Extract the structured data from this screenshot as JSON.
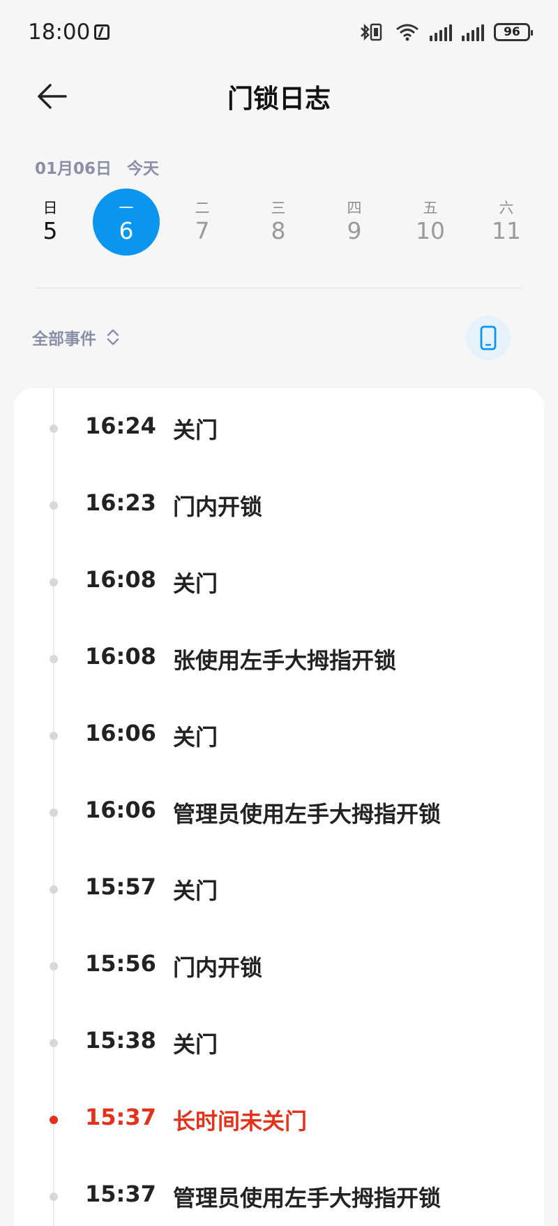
{
  "status_bar": {
    "time": "18:00",
    "battery": "96"
  },
  "header": {
    "title": "门锁日志"
  },
  "date": {
    "current": "01月06日",
    "today_label": "今天"
  },
  "week": [
    {
      "weekday": "日",
      "day": "5"
    },
    {
      "weekday": "一",
      "day": "6"
    },
    {
      "weekday": "二",
      "day": "7"
    },
    {
      "weekday": "三",
      "day": "8"
    },
    {
      "weekday": "四",
      "day": "9"
    },
    {
      "weekday": "五",
      "day": "10"
    },
    {
      "weekday": "六",
      "day": "11"
    }
  ],
  "filter": {
    "label": "全部事件"
  },
  "colors": {
    "accent": "#0a96ef",
    "alert": "#e2321b"
  },
  "logs": [
    {
      "time": "16:24",
      "event": "关门"
    },
    {
      "time": "16:23",
      "event": "门内开锁"
    },
    {
      "time": "16:08",
      "event": "关门"
    },
    {
      "time": "16:08",
      "event": "张使用左手大拇指开锁"
    },
    {
      "time": "16:06",
      "event": "关门"
    },
    {
      "time": "16:06",
      "event": "管理员使用左手大拇指开锁"
    },
    {
      "time": "15:57",
      "event": "关门"
    },
    {
      "time": "15:56",
      "event": "门内开锁"
    },
    {
      "time": "15:38",
      "event": "关门"
    },
    {
      "time": "15:37",
      "event": "长时间未关门"
    },
    {
      "time": "15:37",
      "event": "管理员使用左手大拇指开锁"
    }
  ]
}
